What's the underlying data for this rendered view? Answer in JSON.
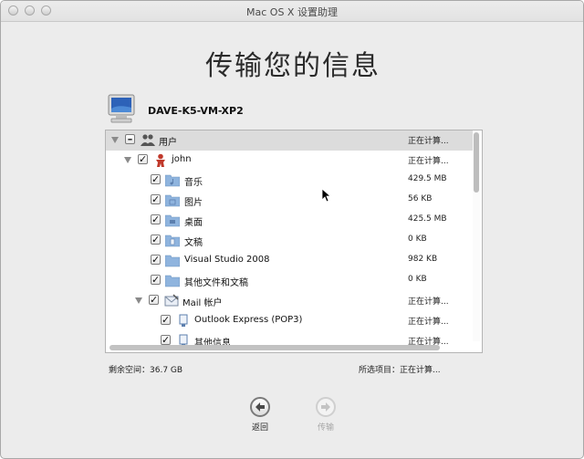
{
  "window": {
    "title": "Mac OS X 设置助理"
  },
  "heading": "传输您的信息",
  "computer": {
    "name": "DAVE-K5-VM-XP2"
  },
  "tree": {
    "rows": [
      {
        "label": "用户",
        "size": "正在计算...",
        "checked": "mixed",
        "icon": "users-icon"
      },
      {
        "label": "john",
        "size": "正在计算...",
        "checked": true,
        "icon": "user-icon"
      },
      {
        "label": "音乐",
        "size": "429.5 MB",
        "checked": true,
        "icon": "music-folder-icon"
      },
      {
        "label": "图片",
        "size": "56 KB",
        "checked": true,
        "icon": "pictures-folder-icon"
      },
      {
        "label": "桌面",
        "size": "425.5 MB",
        "checked": true,
        "icon": "desktop-folder-icon"
      },
      {
        "label": "文稿",
        "size": "0 KB",
        "checked": true,
        "icon": "documents-folder-icon"
      },
      {
        "label": "Visual Studio 2008",
        "size": "982 KB",
        "checked": true,
        "icon": "folder-icon"
      },
      {
        "label": "其他文件和文稿",
        "size": "0 KB",
        "checked": true,
        "icon": "folder-icon"
      },
      {
        "label": "Mail 帐户",
        "size": "正在计算...",
        "checked": true,
        "icon": "mail-icon"
      },
      {
        "label": "Outlook Express (POP3)",
        "size": "正在计算...",
        "checked": true,
        "icon": "mail-account-icon"
      },
      {
        "label": "其他信息",
        "size": "正在计算...",
        "checked": true,
        "icon": "info-icon"
      }
    ]
  },
  "footer": {
    "free_space": "剩余空间：36.7 GB",
    "selected_items": "所选项目：正在计算..."
  },
  "nav": {
    "back_label": "返回",
    "forward_label": "传输"
  },
  "colors": {
    "window_bg": "#ececec",
    "selected_row": "#dcdcdc",
    "folder_blue": "#8fb4de",
    "user_red": "#c0392b"
  }
}
